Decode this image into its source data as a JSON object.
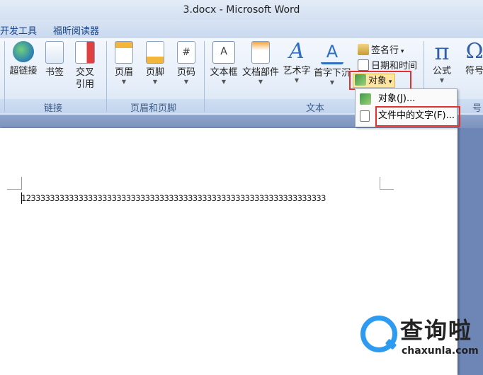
{
  "window": {
    "title": "3.docx - Microsoft Word"
  },
  "tabs": [
    "开发工具",
    "福昕阅读器"
  ],
  "ribbon": {
    "buttons": [
      {
        "label": "超链接",
        "icon": "globe-link-icon"
      },
      {
        "label": "书签",
        "icon": "bookmark-icon"
      },
      {
        "label": "交叉",
        "label2": "引用",
        "icon": "cross-reference-icon"
      },
      {
        "label": "页眉",
        "icon": "header-icon"
      },
      {
        "label": "页脚",
        "icon": "footer-icon"
      },
      {
        "label": "页码",
        "icon": "page-number-icon"
      },
      {
        "label": "文本框",
        "icon": "textbox-icon"
      },
      {
        "label": "文档部件",
        "icon": "quick-parts-icon"
      },
      {
        "label": "艺术字",
        "icon": "wordart-icon"
      },
      {
        "label": "首字下沉",
        "icon": "dropcap-icon"
      },
      {
        "label": "公式",
        "icon": "equation-pi-icon"
      },
      {
        "label": "符号",
        "icon": "symbol-omega-icon"
      }
    ],
    "small": {
      "signature": "签名行",
      "datetime": "日期和时间",
      "object": "对象"
    },
    "groups": {
      "links": "链接",
      "header_footer": "页眉和页脚",
      "text": "文本",
      "symbols": "号"
    }
  },
  "dropdown": {
    "item1": "对象(J)...",
    "item2": "文件中的文字(F)..."
  },
  "document": {
    "text": "1233333333333333333333333333333333333333333333333333333333333333"
  },
  "watermark": {
    "cn": "查询啦",
    "en": "chaxunla.com"
  },
  "colors": {
    "highlight": "#e0312f",
    "accent": "#2c9bf0"
  }
}
